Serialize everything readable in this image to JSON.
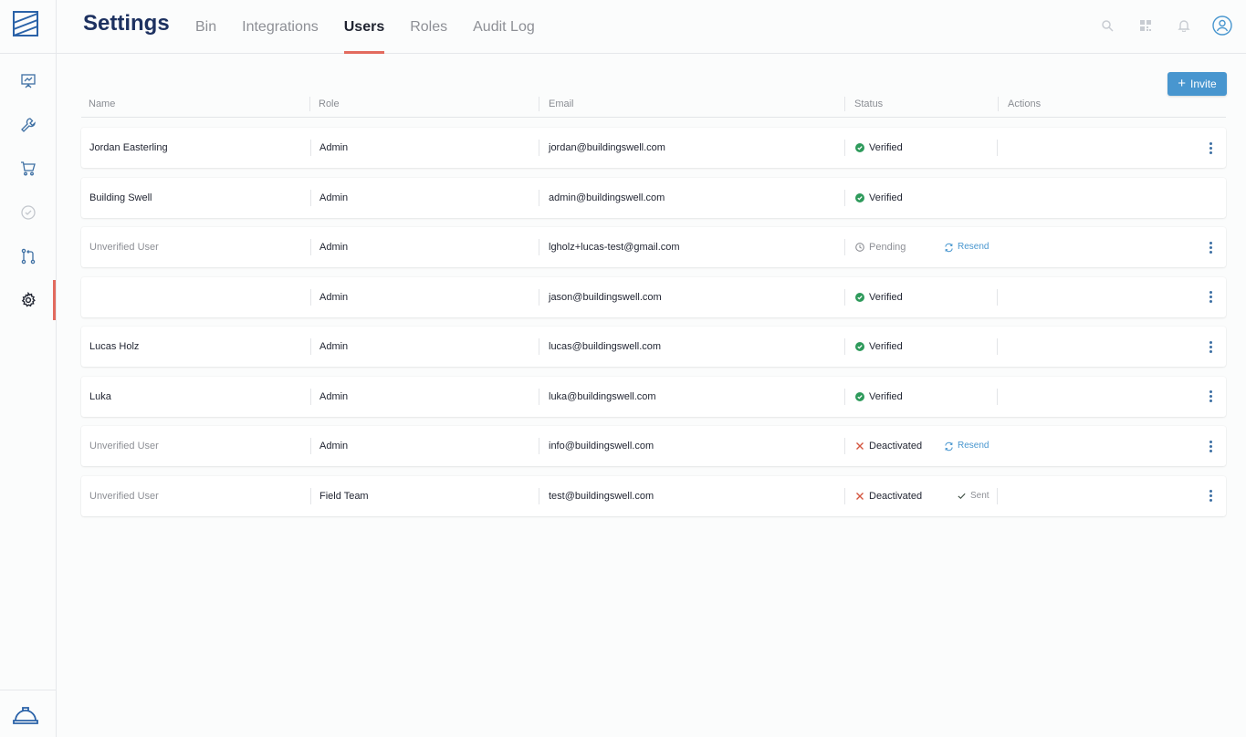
{
  "app": {
    "page_title": "Settings",
    "tabs": [
      {
        "label": "Bin",
        "active": false
      },
      {
        "label": "Integrations",
        "active": false
      },
      {
        "label": "Users",
        "active": true
      },
      {
        "label": "Roles",
        "active": false
      },
      {
        "label": "Audit Log",
        "active": false
      }
    ]
  },
  "sidebar": {
    "items": [
      {
        "icon": "presentation-chart-icon"
      },
      {
        "icon": "wrench-icon"
      },
      {
        "icon": "cart-icon"
      },
      {
        "icon": "check-circle-icon"
      },
      {
        "icon": "pull-request-icon"
      },
      {
        "icon": "gear-icon",
        "active": true
      }
    ],
    "footer_icon": "hard-hat-icon"
  },
  "header_icons": [
    "search-icon",
    "qr-code-icon",
    "bell-icon",
    "user-circle-icon"
  ],
  "invite": {
    "label": "Invite"
  },
  "table": {
    "columns": [
      "Name",
      "Role",
      "Email",
      "Status",
      "Actions"
    ],
    "rows": [
      {
        "name": "Jordan Easterling",
        "name_muted": false,
        "role": "Admin",
        "email": "jordan@buildingswell.com",
        "status": "Verified",
        "status_type": "verified",
        "action": "",
        "action_type": "none",
        "has_menu": true,
        "has_action_sep": true
      },
      {
        "name": "Building Swell",
        "name_muted": false,
        "role": "Admin",
        "email": "admin@buildingswell.com",
        "status": "Verified",
        "status_type": "verified",
        "action": "",
        "action_type": "none",
        "has_menu": false,
        "has_action_sep": false
      },
      {
        "name": "Unverified User",
        "name_muted": true,
        "role": "Admin",
        "email": "lgholz+lucas-test@gmail.com",
        "status": "Pending",
        "status_type": "pending",
        "action": "Resend",
        "action_type": "resend",
        "has_menu": true,
        "has_action_sep": false
      },
      {
        "name": "",
        "name_muted": false,
        "role": "Admin",
        "email": "jason@buildingswell.com",
        "status": "Verified",
        "status_type": "verified",
        "action": "",
        "action_type": "none",
        "has_menu": true,
        "has_action_sep": true
      },
      {
        "name": "Lucas Holz",
        "name_muted": false,
        "role": "Admin",
        "email": "lucas@buildingswell.com",
        "status": "Verified",
        "status_type": "verified",
        "action": "",
        "action_type": "none",
        "has_menu": true,
        "has_action_sep": true
      },
      {
        "name": "Luka",
        "name_muted": false,
        "role": "Admin",
        "email": "luka@buildingswell.com",
        "status": "Verified",
        "status_type": "verified",
        "action": "",
        "action_type": "none",
        "has_menu": true,
        "has_action_sep": true
      },
      {
        "name": "Unverified User",
        "name_muted": true,
        "role": "Admin",
        "email": "info@buildingswell.com",
        "status": "Deactivated",
        "status_type": "deactivated",
        "action": "Resend",
        "action_type": "resend",
        "has_menu": true,
        "has_action_sep": false
      },
      {
        "name": "Unverified User",
        "name_muted": true,
        "role": "Field Team",
        "email": "test@buildingswell.com",
        "status": "Deactivated",
        "status_type": "deactivated",
        "action": "Sent",
        "action_type": "sent",
        "has_menu": true,
        "has_action_sep": true
      }
    ]
  },
  "colors": {
    "brand_navy": "#1d3160",
    "accent_red": "#e26a5e",
    "link_blue": "#4896cf",
    "verified_green": "#2e9a5b",
    "deactivated_red": "#d4553f",
    "muted_gray": "#8d8f95"
  }
}
